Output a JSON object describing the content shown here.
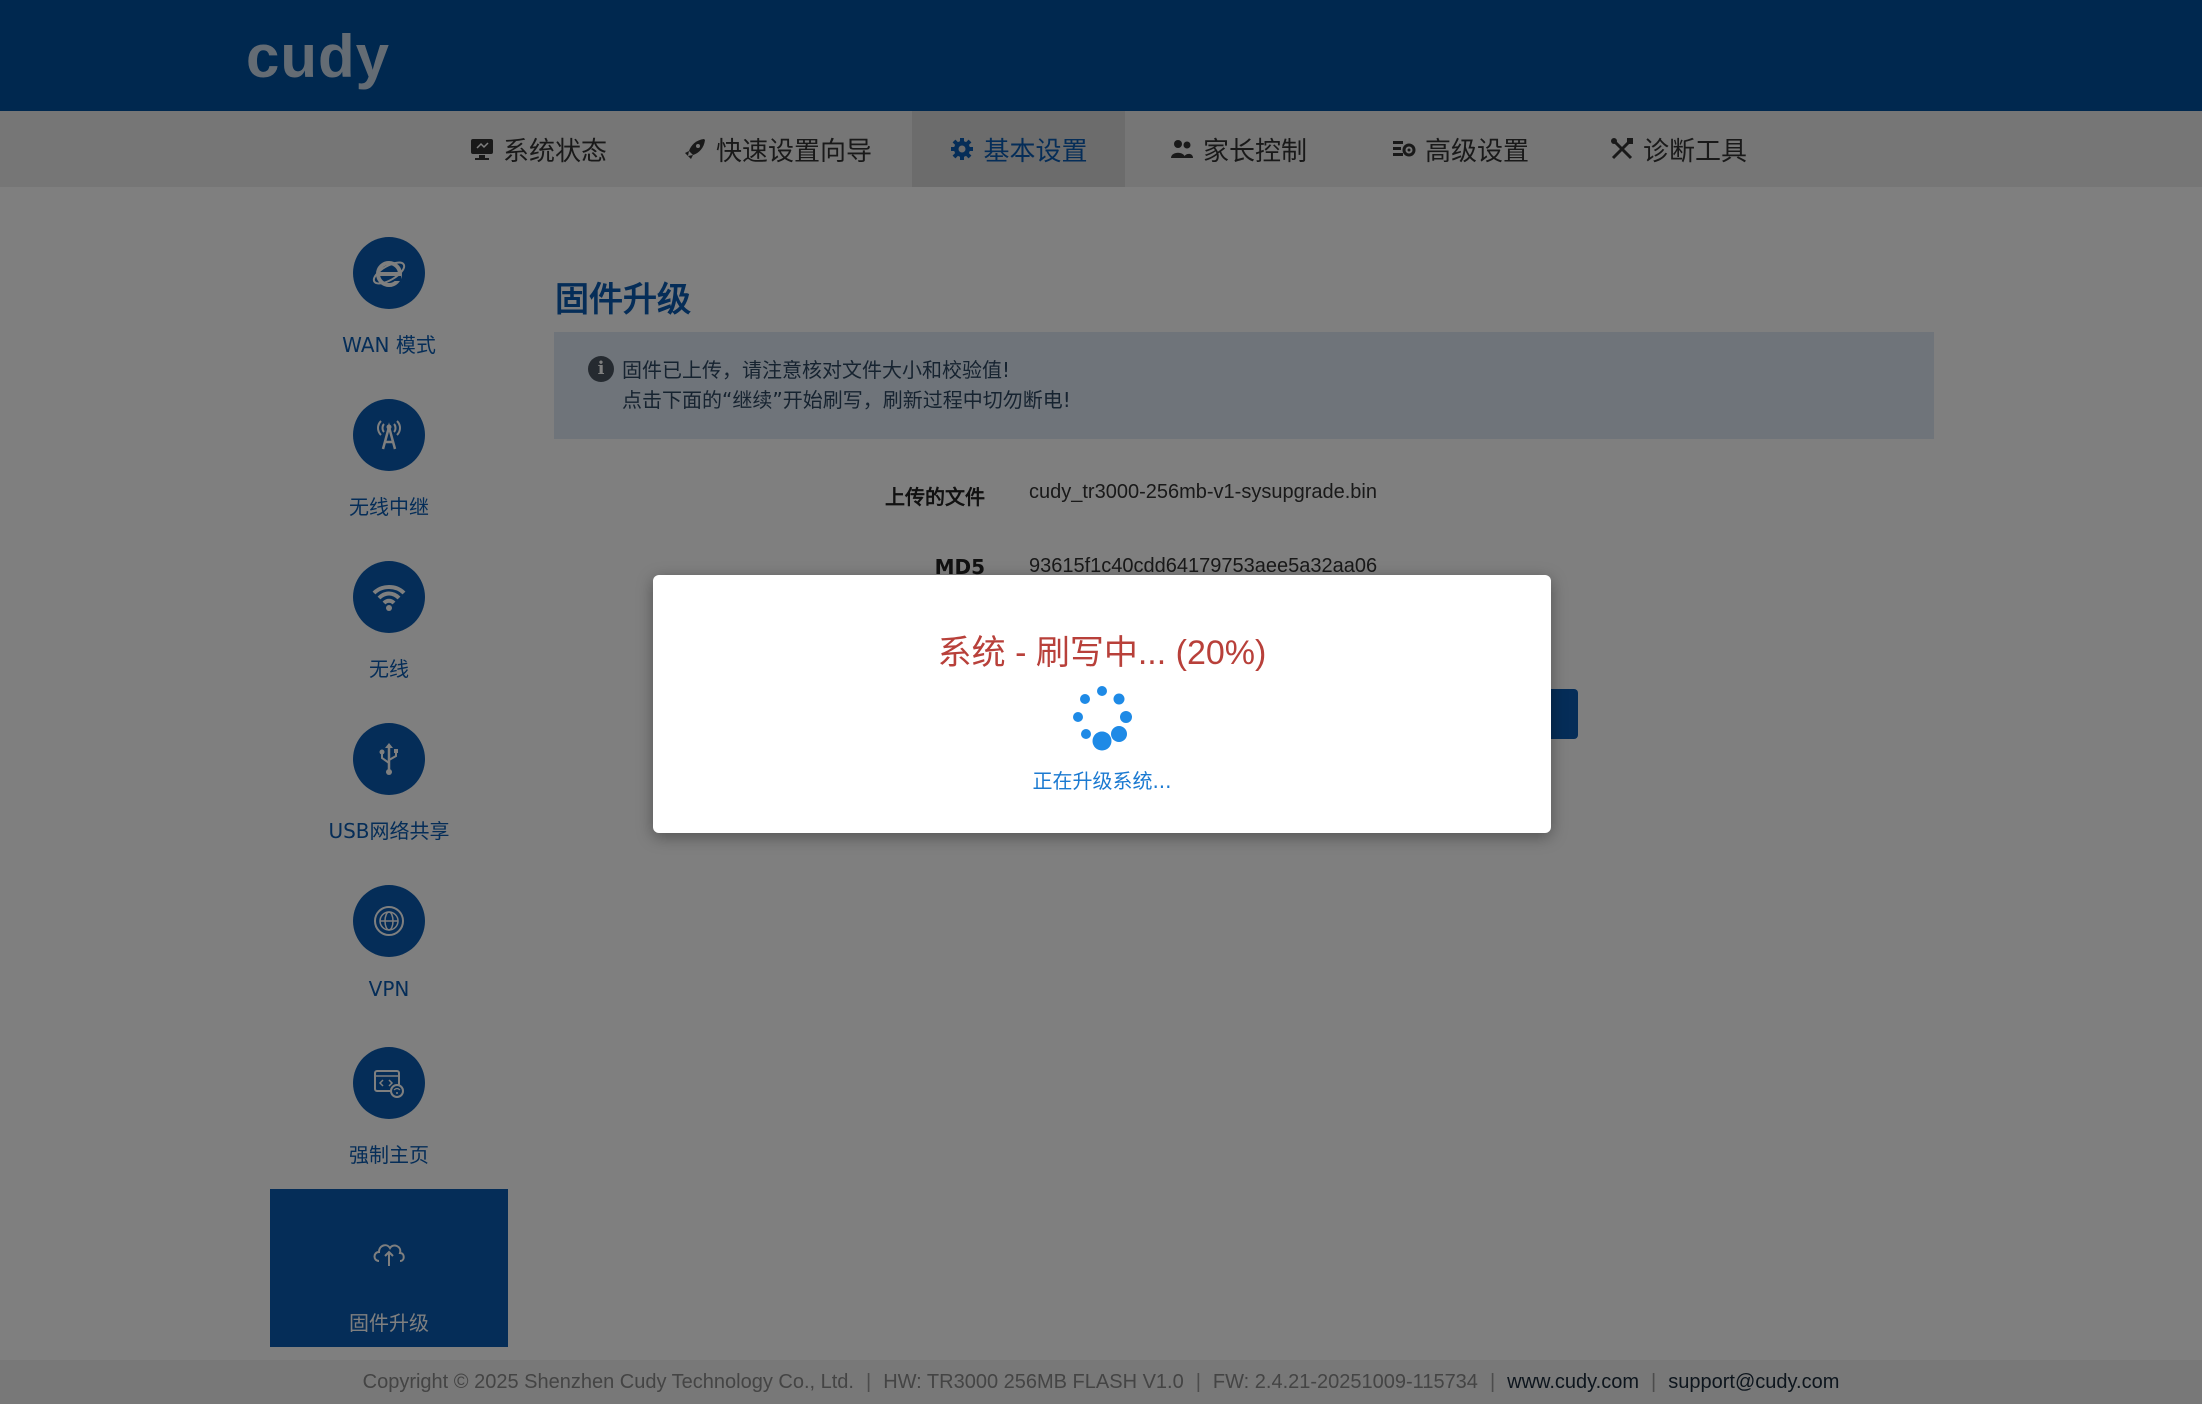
{
  "header": {
    "logo_text": "cudy",
    "color": "#00509f"
  },
  "nav": {
    "items": [
      {
        "label": "系统状态",
        "icon": "monitor-icon"
      },
      {
        "label": "快速设置向导",
        "icon": "rocket-icon"
      },
      {
        "label": "基本设置",
        "icon": "gear-icon",
        "active": true
      },
      {
        "label": "家长控制",
        "icon": "users-icon"
      },
      {
        "label": "高级设置",
        "icon": "sliders-icon"
      },
      {
        "label": "诊断工具",
        "icon": "tools-icon"
      }
    ]
  },
  "sidebar": {
    "items": [
      {
        "label": "WAN 模式",
        "icon": "internet-explorer-icon"
      },
      {
        "label": "无线中继",
        "icon": "antenna-icon"
      },
      {
        "label": "无线",
        "icon": "wifi-icon"
      },
      {
        "label": "USB网络共享",
        "icon": "usb-icon"
      },
      {
        "label": "VPN",
        "icon": "globe-icon"
      },
      {
        "label": "强制主页",
        "icon": "portal-icon"
      },
      {
        "label": "固件升级",
        "icon": "cloud-upload-icon",
        "active": true
      }
    ]
  },
  "main": {
    "title": "固件升级",
    "info": {
      "line1": "固件已上传，请注意核对文件大小和校验值!",
      "line2": "点击下面的“继续”开始刷写，刷新过程中切勿断电!"
    },
    "fields": [
      {
        "label": "上传的文件",
        "value": "cudy_tr3000-256mb-v1-sysupgrade.bin"
      },
      {
        "label": "MD5",
        "value": "93615f1c40cdd64179753aee5a32aa06"
      }
    ]
  },
  "modal": {
    "title": "系统 - 刷写中... (20%)",
    "progress_percent": 20,
    "subtitle": "正在升级系统..."
  },
  "footer": {
    "copyright": "Copyright © 2025 Shenzhen Cudy Technology Co., Ltd.",
    "hw": "HW: TR3000 256MB FLASH V1.0",
    "fw": "FW: 2.4.21-20251009-115734",
    "website": "www.cudy.com",
    "support": "support@cudy.com"
  },
  "colors": {
    "accent": "#0a5bb0",
    "modal_title": "#b8403a",
    "spinner": "#1e8ae6"
  }
}
